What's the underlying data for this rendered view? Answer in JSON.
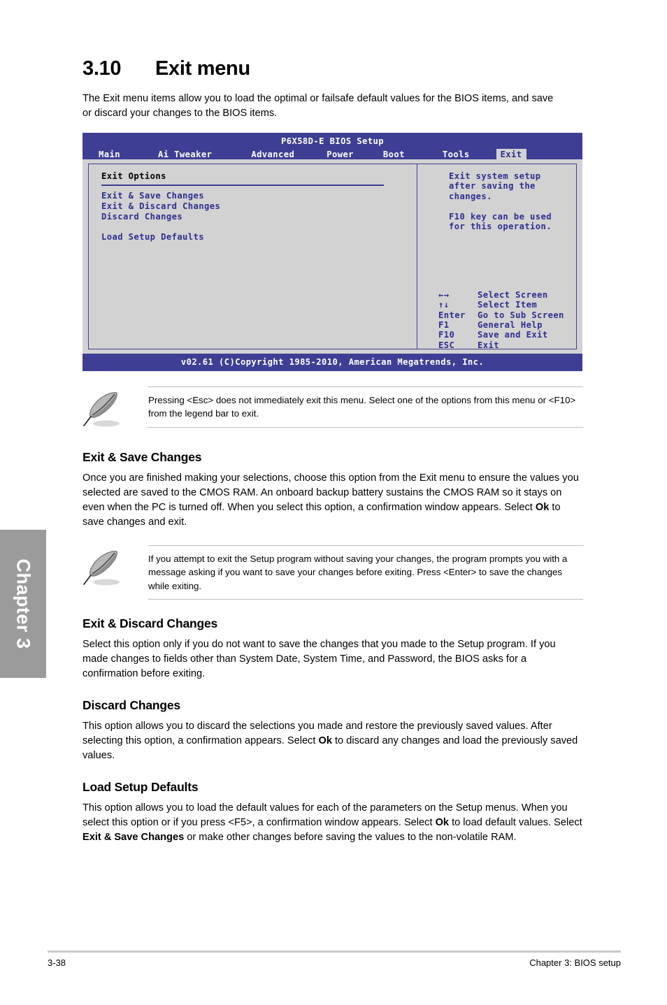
{
  "section": {
    "number": "3.10",
    "title": "Exit menu",
    "intro": "The Exit menu items allow you to load the optimal or failsafe default values for the BIOS items, and save or discard your changes to the BIOS items."
  },
  "bios": {
    "title": "P6X58D-E BIOS Setup",
    "tabs": [
      {
        "label": "Main",
        "selected": false
      },
      {
        "label": "Ai Tweaker",
        "selected": false
      },
      {
        "label": "Advanced",
        "selected": false
      },
      {
        "label": "Power",
        "selected": false
      },
      {
        "label": "Boot",
        "selected": false
      },
      {
        "label": "Tools",
        "selected": false
      },
      {
        "label": "Exit",
        "selected": true
      }
    ],
    "options_header": "Exit Options",
    "options": [
      "Exit & Save Changes",
      "Exit & Discard Changes",
      "Discard Changes"
    ],
    "options_second_group": [
      "Load Setup Defaults"
    ],
    "help": {
      "line1": "Exit system setup",
      "line2": "after saving the",
      "line3": "changes.",
      "line4": "F10 key can be used",
      "line5": "for this operation."
    },
    "legend": [
      {
        "key": "←→",
        "action": "Select Screen"
      },
      {
        "key": "↑↓",
        "action": "Select Item"
      },
      {
        "key": "Enter",
        "action": "Go to Sub Screen"
      },
      {
        "key": "F1",
        "action": "General Help"
      },
      {
        "key": "F10",
        "action": "Save and Exit"
      },
      {
        "key": "ESC",
        "action": "Exit"
      }
    ],
    "footer": "v02.61 (C)Copyright 1985-2010, American Megatrends, Inc.",
    "colors": {
      "header_blue": "#3e3e94",
      "body_gray": "#d2d2d2",
      "text_blue": "#2e2e8f"
    }
  },
  "notes": [
    {
      "icon": "quill-pen-icon",
      "text": "Pressing <Esc> does not immediately exit this menu. Select one of the options from this menu or <F10> from the legend bar to exit."
    },
    {
      "icon": "quill-pen-icon",
      "text": "If you attempt to exit the Setup program without saving your changes, the program prompts you with a message asking if you want to save your changes before exiting. Press <Enter> to save the changes while exiting."
    }
  ],
  "subsections": [
    {
      "heading": "Exit & Save Changes",
      "parts": [
        {
          "text": "Once you are finished making your selections, choose this option from the Exit menu to ensure the values you selected are saved to the CMOS RAM. An onboard backup battery sustains the CMOS RAM so it stays on even when the PC is turned off. When you select this option, a confirmation window appears. Select ",
          "bold": false
        },
        {
          "text": "Ok",
          "bold": true
        },
        {
          "text": " to save changes and exit.",
          "bold": false
        }
      ]
    },
    {
      "heading": "Exit & Discard Changes",
      "parts": [
        {
          "text": "Select this option only if you do not want to save the changes that you  made to the Setup program. If you made changes to fields other than System Date, System Time, and Password, the BIOS asks for a confirmation before exiting.",
          "bold": false
        }
      ]
    },
    {
      "heading": "Discard Changes",
      "parts": [
        {
          "text": "This option allows you to discard the selections you made and restore the previously saved values. After selecting this option, a confirmation appears. Select ",
          "bold": false
        },
        {
          "text": "Ok",
          "bold": true
        },
        {
          "text": " to discard any changes and load the previously saved values.",
          "bold": false
        }
      ]
    },
    {
      "heading": "Load Setup Defaults",
      "parts": [
        {
          "text": "This option allows you to load the default values for each of the parameters on the Setup menus. When you select this option or if you press <F5>, a confirmation window appears. Select ",
          "bold": false
        },
        {
          "text": "Ok",
          "bold": true
        },
        {
          "text": " to load default values. Select ",
          "bold": false
        },
        {
          "text": "Exit & Save Changes",
          "bold": true
        },
        {
          "text": " or make other changes before saving the values to the non-volatile RAM.",
          "bold": false
        }
      ]
    }
  ],
  "chapter_tab": {
    "label": "Chapter 3"
  },
  "page_footer": {
    "page_number": "3-38",
    "chapter_title": "Chapter 3: BIOS setup"
  }
}
